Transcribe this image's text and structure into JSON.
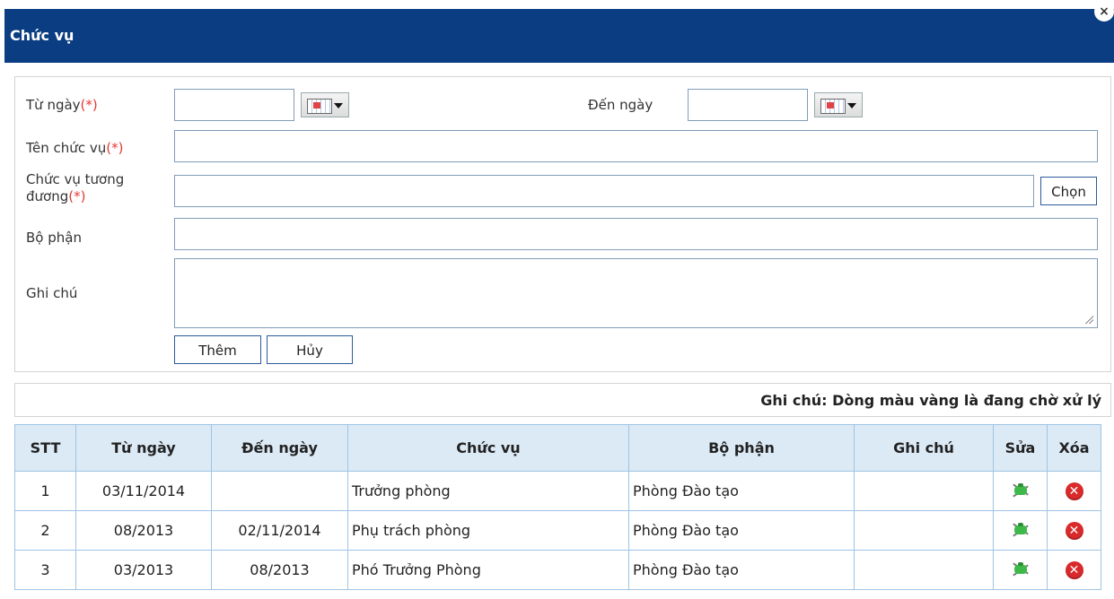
{
  "window": {
    "title": "Chức vụ",
    "close_glyph": "×"
  },
  "form": {
    "from_date": {
      "label": "Từ ngày",
      "required": "(*)",
      "value": ""
    },
    "to_date": {
      "label": "Đến ngày",
      "value": ""
    },
    "position_name": {
      "label": "Tên chức vụ",
      "required": "(*)",
      "value": ""
    },
    "equivalent": {
      "label_line1": "Chức vụ tương",
      "label_line2": "đương",
      "required": "(*)",
      "value": "",
      "choose_label": "Chọn"
    },
    "department": {
      "label": "Bộ phận",
      "value": ""
    },
    "note": {
      "label": "Ghi chú",
      "value": ""
    },
    "add_label": "Thêm",
    "cancel_label": "Hủy"
  },
  "legend_note": "Ghi chú: Dòng màu vàng là đang chờ xử lý",
  "table": {
    "headers": [
      "STT",
      "Từ ngày",
      "Đến ngày",
      "Chức vụ",
      "Bộ phận",
      "Ghi chú",
      "Sửa",
      "Xóa"
    ],
    "rows": [
      {
        "stt": "1",
        "from": "03/11/2014",
        "to": "",
        "position": "Trưởng phòng",
        "department": "Phòng Đào tạo",
        "note": ""
      },
      {
        "stt": "2",
        "from": "08/2013",
        "to": "02/11/2014",
        "position": "Phụ trách phòng",
        "department": "Phòng Đào tạo",
        "note": ""
      },
      {
        "stt": "3",
        "from": "03/2013",
        "to": "08/2013",
        "position": "Phó Trưởng Phòng",
        "department": "Phòng Đào tạo",
        "note": ""
      }
    ]
  },
  "icons": {
    "calendar": "calendar-icon",
    "edit": "edit-bug-icon",
    "delete": "delete-icon"
  },
  "colors": {
    "titlebar": "#0a3d82",
    "required": "#e53935",
    "header_bg": "#dceaf6",
    "delete": "#d9292b"
  }
}
